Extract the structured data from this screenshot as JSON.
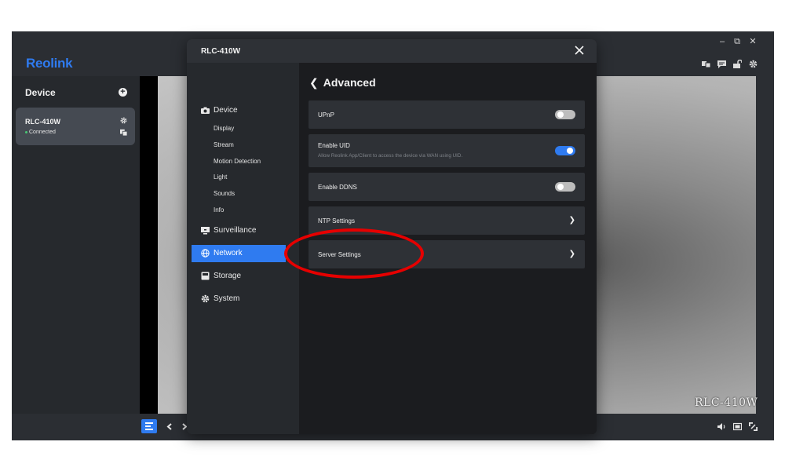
{
  "app": {
    "logo_text": "Reolink",
    "window_controls": [
      "–",
      "⧉",
      "✕"
    ],
    "top_icons": [
      "layout-icon",
      "message-icon",
      "unlock-icon",
      "settings-gear-icon"
    ]
  },
  "sidebar": {
    "title": "Device",
    "device": {
      "name": "RLC-410W",
      "status": "Connected",
      "status_color": "#48c774"
    }
  },
  "video": {
    "overlay_label": "RLC-410W"
  },
  "modal": {
    "title": "RLC-410W",
    "nav": {
      "device": "Device",
      "sub_items": [
        "Display",
        "Stream",
        "Motion Detection",
        "Light",
        "Sounds",
        "Info"
      ],
      "surveillance": "Surveillance",
      "network": "Network",
      "storage": "Storage",
      "system": "System"
    },
    "content": {
      "title": "Advanced",
      "rows": {
        "upnp": {
          "label": "UPnP",
          "enabled": false
        },
        "uid": {
          "label": "Enable UID",
          "description": "Allow Reolink App/Client to access the device via WAN using UID.",
          "enabled": true
        },
        "ddns": {
          "label": "Enable DDNS",
          "enabled": false
        },
        "ntp": {
          "label": "NTP Settings"
        },
        "server": {
          "label": "Server Settings"
        }
      }
    }
  },
  "colors": {
    "accent": "#2f7bf0",
    "highlight": "#e60000",
    "panel": "#2e3136",
    "background": "#1b1c1f"
  }
}
